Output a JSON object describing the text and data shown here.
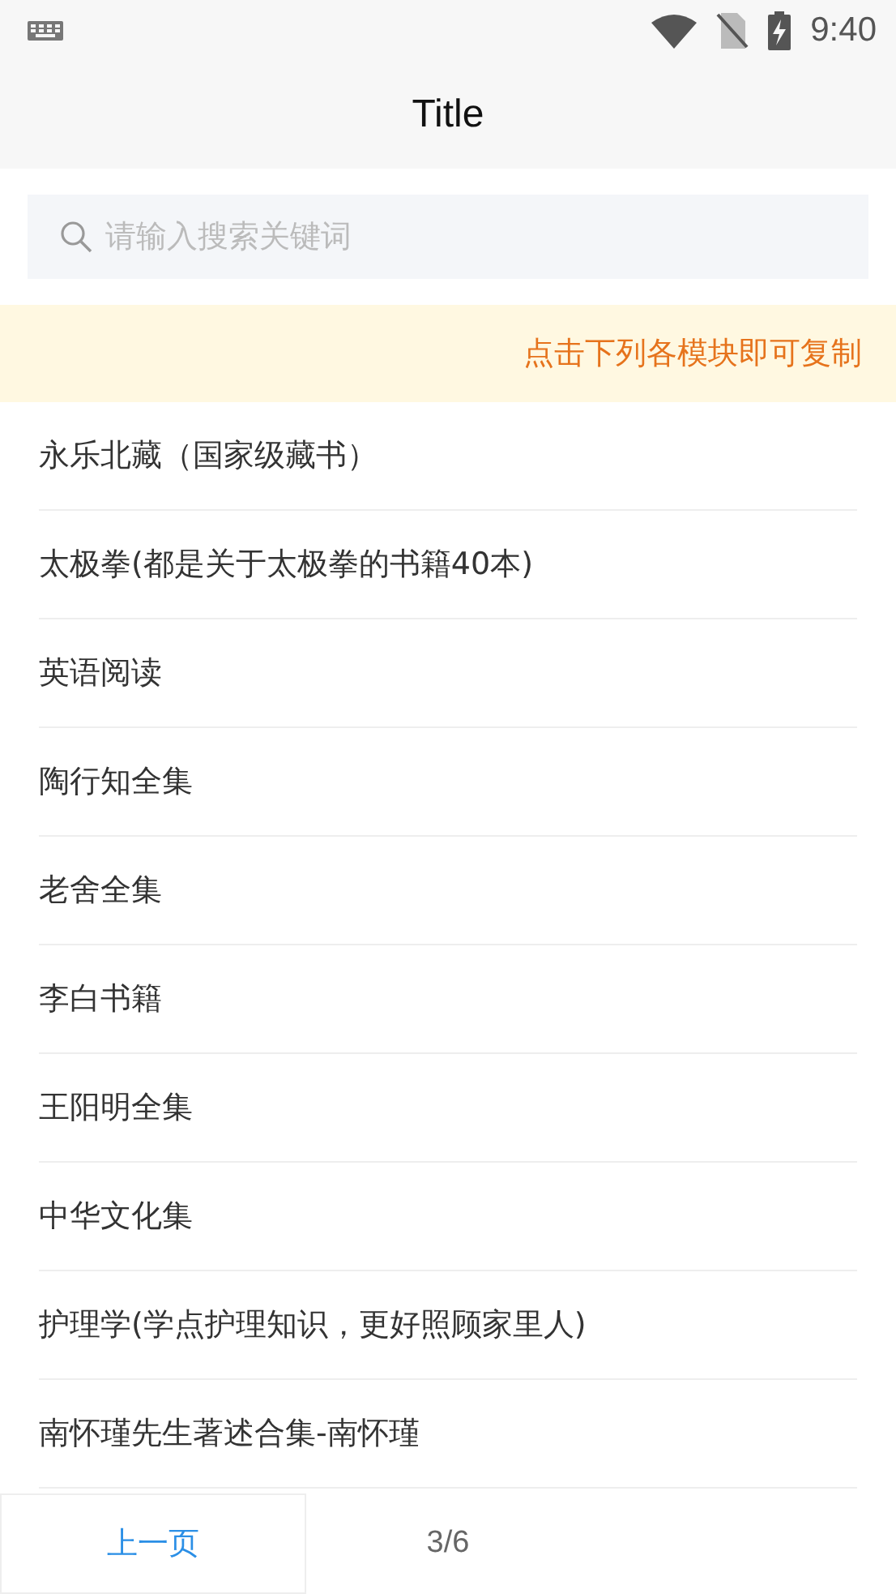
{
  "status_bar": {
    "time": "9:40"
  },
  "header": {
    "title": "Title"
  },
  "search": {
    "placeholder": "请输入搜索关键词"
  },
  "notice": {
    "text": "点击下列各模块即可复制"
  },
  "items": [
    {
      "label": "永乐北藏（国家级藏书）"
    },
    {
      "label": "太极拳(都是关于太极拳的书籍40本)"
    },
    {
      "label": "英语阅读"
    },
    {
      "label": "陶行知全集"
    },
    {
      "label": "老舍全集"
    },
    {
      "label": "李白书籍"
    },
    {
      "label": "王阳明全集"
    },
    {
      "label": "中华文化集"
    },
    {
      "label": "护理学(学点护理知识，更好照顾家里人)"
    },
    {
      "label": "南怀瑾先生著述合集-南怀瑾"
    }
  ],
  "pager": {
    "prev": "上一页",
    "page": "3/6"
  }
}
